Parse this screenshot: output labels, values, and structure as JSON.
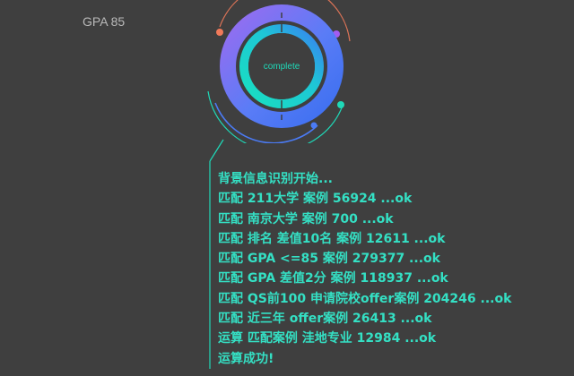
{
  "header": {
    "gpa_label": "GPA 85"
  },
  "progress": {
    "status_text": "complete"
  },
  "log": {
    "lines": [
      "背景信息识别开始...",
      "匹配 211大学 案例 56924 ...ok",
      "匹配 南京大学 案例 700 ...ok",
      "匹配 排名 差值10名 案例 12611 ...ok",
      "匹配 GPA <=85 案例 279377 ...ok",
      "匹配 GPA 差值2分 案例 118937 ...ok",
      "匹配 QS前100 申请院校offer案例 204246 ...ok",
      "匹配 近三年 offer案例 26413 ...ok",
      "运算 匹配案例 洼地专业 12984 ...ok",
      "运算成功!"
    ]
  },
  "colors": {
    "background": "#3f3f3f",
    "accent_teal": "#1fd9b8",
    "accent_blue": "#4b7bf5",
    "accent_purple": "#9a6cf0",
    "accent_orange": "#f07a5a",
    "log_text": "#34e0c4"
  }
}
